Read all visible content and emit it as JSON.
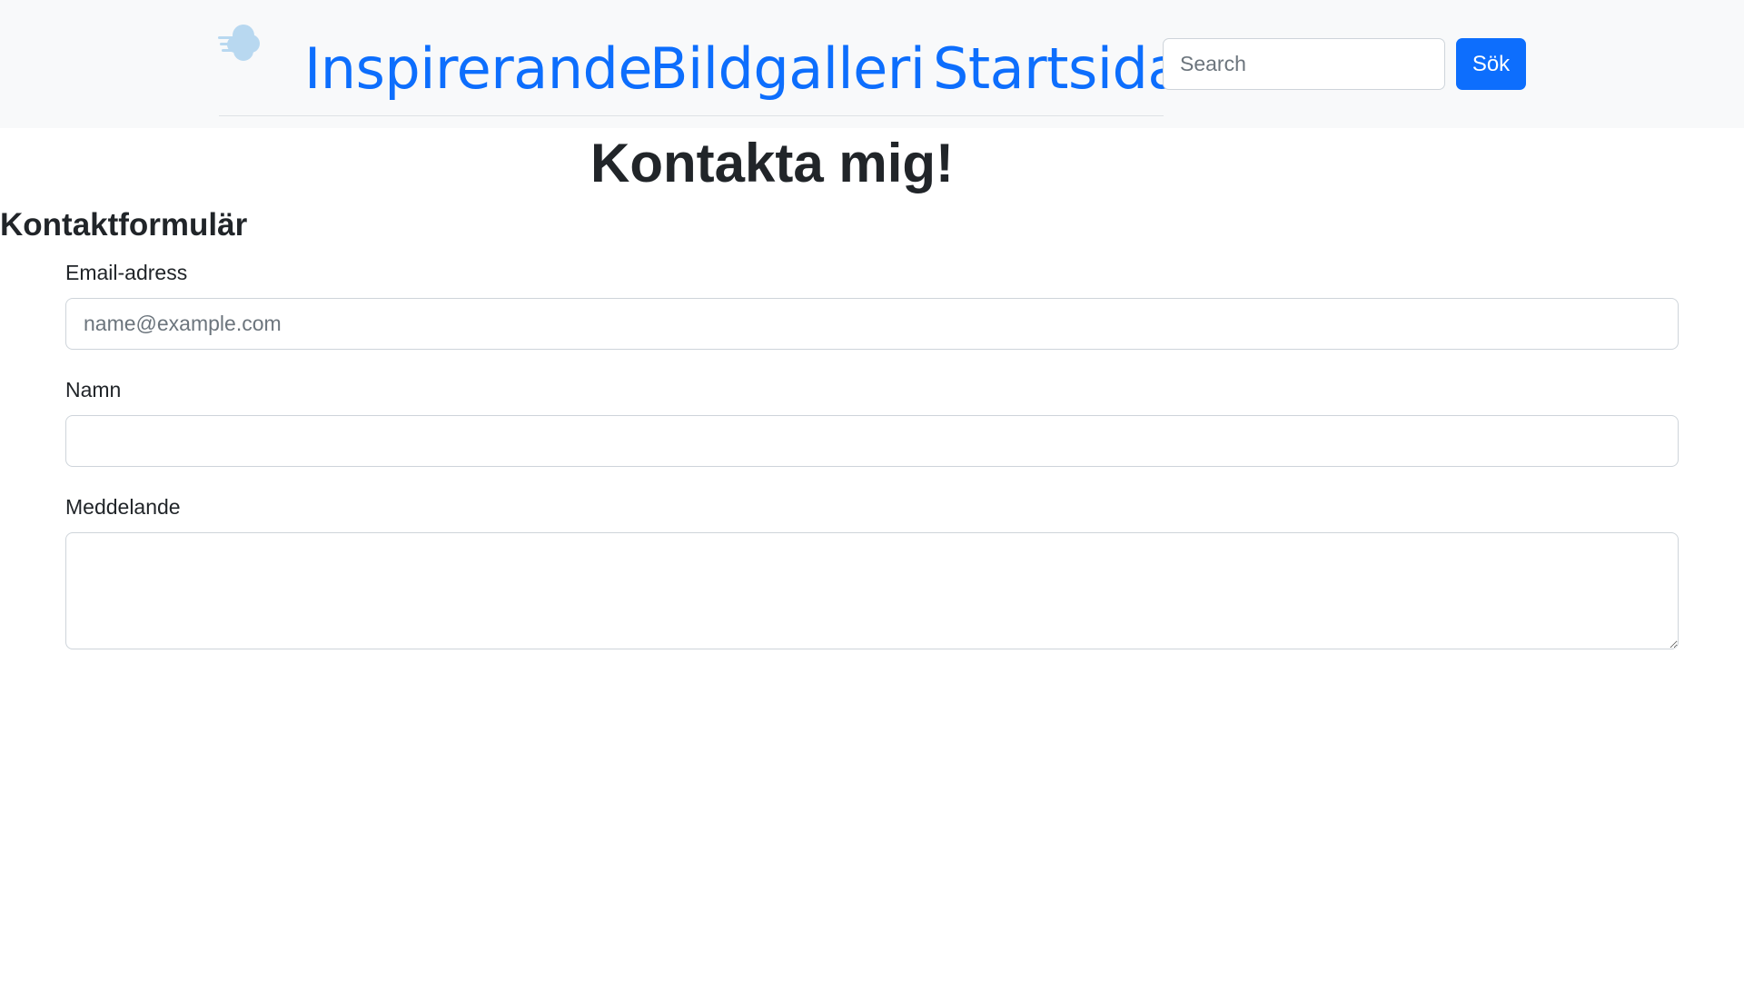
{
  "navbar": {
    "logo_icon": "wind-cloud-icon",
    "links": [
      {
        "label": "Inspirerande"
      },
      {
        "label": "Bildgalleri"
      },
      {
        "label": "Startsida"
      }
    ],
    "search": {
      "placeholder": "Search",
      "value": "",
      "button_label": "Sök"
    },
    "link_color": "#0d6efd",
    "button_color": "#0d6efd"
  },
  "main": {
    "title": "Kontakta mig!",
    "form": {
      "heading": "Kontaktformulär",
      "email": {
        "label": "Email-adress",
        "placeholder": "name@example.com",
        "value": ""
      },
      "name": {
        "label": "Namn",
        "value": ""
      },
      "message": {
        "label": "Meddelande",
        "value": ""
      }
    }
  }
}
